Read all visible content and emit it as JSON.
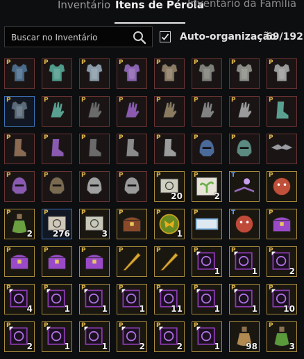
{
  "tabs": [
    {
      "label": "Inventário"
    },
    {
      "label": "Itens de Pérola"
    },
    {
      "label": "Inventário da Família"
    }
  ],
  "search": {
    "placeholder": "Buscar no Inventário"
  },
  "auto_organize": {
    "label": "Auto-organização",
    "checked": true
  },
  "capacity": "69/192",
  "slot_mark": "P",
  "slot_mark_alt": "T",
  "colors": {
    "border_red": "#6b3434",
    "border_gold": "#a88a3c",
    "border_blue": "#3f73b8"
  },
  "slots": [
    {
      "icon": "costume-armor-icon",
      "color": "#4a6a8a",
      "qty": "",
      "mark": "P",
      "border": "red"
    },
    {
      "icon": "teal-armor-icon",
      "color": "#4f9a8a",
      "qty": "",
      "mark": "P",
      "border": "red"
    },
    {
      "icon": "gold-armor-icon",
      "color": "#8a9aa8",
      "qty": "",
      "mark": "P",
      "border": "red"
    },
    {
      "icon": "purple-armor-icon",
      "color": "#8a62b0",
      "qty": "",
      "mark": "P",
      "border": "red"
    },
    {
      "icon": "bronze-armor-icon",
      "color": "#8a7a62",
      "qty": "",
      "mark": "P",
      "border": "red"
    },
    {
      "icon": "grey-armor-icon",
      "color": "#7e7e78",
      "qty": "",
      "mark": "P",
      "border": "red"
    },
    {
      "icon": "grey-armor-icon",
      "color": "#8c8c86",
      "qty": "",
      "mark": "P",
      "border": "red"
    },
    {
      "icon": "silver-armor-icon",
      "color": "#9a9a9a",
      "qty": "",
      "mark": "P",
      "border": "red"
    },
    {
      "icon": "dark-armor-icon",
      "color": "#5a6a7a",
      "qty": "",
      "mark": "P",
      "border": "blue"
    },
    {
      "icon": "teal-gloves-icon",
      "color": "#5aa090",
      "qty": "",
      "mark": "P",
      "border": "red"
    },
    {
      "icon": "gold-gloves-icon",
      "color": "#6a6a6a",
      "qty": "",
      "mark": "P",
      "border": "red"
    },
    {
      "icon": "purple-gloves-icon",
      "color": "#8a5ab0",
      "qty": "",
      "mark": "P",
      "border": "red"
    },
    {
      "icon": "bronze-gloves-icon",
      "color": "#8a7a60",
      "qty": "",
      "mark": "P",
      "border": "red"
    },
    {
      "icon": "grey-gloves-icon",
      "color": "#828282",
      "qty": "",
      "mark": "P",
      "border": "red"
    },
    {
      "icon": "silver-gloves-icon",
      "color": "#9a9a9a",
      "qty": "",
      "mark": "P",
      "border": "red"
    },
    {
      "icon": "teal-boots-icon",
      "color": "#5aa090",
      "qty": "",
      "mark": "P",
      "border": "red"
    },
    {
      "icon": "brown-boots-icon",
      "color": "#8a6a52",
      "qty": "",
      "mark": "P",
      "border": "red"
    },
    {
      "icon": "purple-boots-icon",
      "color": "#8a5ab0",
      "qty": "",
      "mark": "P",
      "border": "red"
    },
    {
      "icon": "dark-boots-icon",
      "color": "#6a6a6a",
      "qty": "",
      "mark": "P",
      "border": "red"
    },
    {
      "icon": "grey-boots-icon",
      "color": "#8a8a8a",
      "qty": "",
      "mark": "P",
      "border": "red"
    },
    {
      "icon": "silver-boots-icon",
      "color": "#9c9c9c",
      "qty": "",
      "mark": "P",
      "border": "red"
    },
    {
      "icon": "blue-helmet-icon",
      "color": "#4a6a9a",
      "qty": "",
      "mark": "P",
      "border": "red"
    },
    {
      "icon": "teal-helmet-icon",
      "color": "#5a8a80",
      "qty": "",
      "mark": "P",
      "border": "red"
    },
    {
      "icon": "winged-mask-icon",
      "color": "#9a9aa0",
      "qty": "",
      "mark": "P",
      "border": "red"
    },
    {
      "icon": "purple-helmet-icon",
      "color": "#8a5ab0",
      "qty": "",
      "mark": "P",
      "border": "red"
    },
    {
      "icon": "gold-helmet-icon",
      "color": "#7a6a50",
      "qty": "",
      "mark": "P",
      "border": "red"
    },
    {
      "icon": "silver-helmet-icon",
      "color": "#a0a0a0",
      "qty": "",
      "mark": "P",
      "border": "red"
    },
    {
      "icon": "knight-helmet-icon",
      "color": "#9a9a9a",
      "qty": "",
      "mark": "P",
      "border": "red"
    },
    {
      "icon": "scroll-icon",
      "color": "#cfcfc0",
      "qty": "20",
      "mark": "P",
      "border": "gold"
    },
    {
      "icon": "sprout-icon",
      "color": "#6ab04a",
      "qty": "2",
      "mark": "P",
      "border": "gold"
    },
    {
      "icon": "magic-book-icon",
      "color": "#9a6ac0",
      "qty": "",
      "mark": "T",
      "border": "gold"
    },
    {
      "icon": "red-creature-icon",
      "color": "#c0503a",
      "qty": "",
      "mark": "P",
      "border": "gold"
    },
    {
      "icon": "potion-green-icon",
      "color": "#6aa040",
      "qty": "2",
      "mark": "P",
      "border": "gold"
    },
    {
      "icon": "scroll-red-icon",
      "color": "#d0c8b8",
      "qty": "276",
      "mark": "P",
      "border": "blue"
    },
    {
      "icon": "scroll-icon",
      "color": "#c8c8b8",
      "qty": "3",
      "mark": "P",
      "border": "gold"
    },
    {
      "icon": "chest-brown-icon",
      "color": "#8a4a2a",
      "qty": "",
      "mark": "P",
      "border": "gold"
    },
    {
      "icon": "butterfly-coin-icon",
      "color": "#e8b020",
      "qty": "1",
      "mark": "P",
      "border": "gold"
    },
    {
      "icon": "blue-cards-icon",
      "color": "#7ab0e0",
      "qty": "",
      "mark": "P",
      "border": "gold"
    },
    {
      "icon": "red-creature-icon",
      "color": "#c04a3a",
      "qty": "",
      "mark": "T",
      "border": "gold"
    },
    {
      "icon": "purple-chest-icon",
      "color": "#9a4ac8",
      "qty": "",
      "mark": "P",
      "border": "gold"
    },
    {
      "icon": "purple-chest-icon",
      "color": "#9a4ac8",
      "qty": "",
      "mark": "P",
      "border": "gold"
    },
    {
      "icon": "purple-chest-icon",
      "color": "#9a4ac8",
      "qty": "",
      "mark": "P",
      "border": "gold"
    },
    {
      "icon": "purple-chest-icon",
      "color": "#9a4ac8",
      "qty": "",
      "mark": "P",
      "border": "gold"
    },
    {
      "icon": "gold-feather-icon",
      "color": "#d8a830",
      "qty": "",
      "mark": "P",
      "border": "gold"
    },
    {
      "icon": "gold-feather-icon",
      "color": "#d8a830",
      "qty": "",
      "mark": "P",
      "border": "gold"
    },
    {
      "icon": "pearl-coupon-icon",
      "color": "#8a3ab0",
      "qty": "1",
      "mark": "P",
      "border": "gold"
    },
    {
      "icon": "pearl-coupon-icon",
      "color": "#8a3ab0",
      "qty": "1",
      "mark": "P",
      "border": "gold"
    },
    {
      "icon": "pearl-coupon-icon",
      "color": "#8a3ab0",
      "qty": "2",
      "mark": "P",
      "border": "gold"
    },
    {
      "icon": "pearl-coupon-icon",
      "color": "#8a3ab0",
      "qty": "4",
      "mark": "P",
      "border": "gold"
    },
    {
      "icon": "pearl-coupon-icon",
      "color": "#8a3ab0",
      "qty": "1",
      "mark": "P",
      "border": "gold"
    },
    {
      "icon": "pearl-coupon-icon",
      "color": "#8a3ab0",
      "qty": "1",
      "mark": "P",
      "border": "gold"
    },
    {
      "icon": "pearl-coupon-icon",
      "color": "#8a3ab0",
      "qty": "1",
      "mark": "P",
      "border": "gold"
    },
    {
      "icon": "pearl-coupon-icon",
      "color": "#8a3ab0",
      "qty": "11",
      "mark": "P",
      "border": "gold"
    },
    {
      "icon": "pearl-coupon-icon",
      "color": "#8a3ab0",
      "qty": "1",
      "mark": "P",
      "border": "gold"
    },
    {
      "icon": "pearl-coupon-icon",
      "color": "#8a3ab0",
      "qty": "1",
      "mark": "P",
      "border": "gold"
    },
    {
      "icon": "pearl-coupon-icon",
      "color": "#8a3ab0",
      "qty": "10",
      "mark": "P",
      "border": "gold"
    },
    {
      "icon": "pearl-coupon-icon",
      "color": "#8a3ab0",
      "qty": "2",
      "mark": "P",
      "border": "gold"
    },
    {
      "icon": "pearl-coupon-icon",
      "color": "#8a3ab0",
      "qty": "1",
      "mark": "P",
      "border": "gold"
    },
    {
      "icon": "pearl-coupon-icon",
      "color": "#8a3ab0",
      "qty": "1",
      "mark": "P",
      "border": "gold"
    },
    {
      "icon": "pearl-coupon-icon",
      "color": "#8a3ab0",
      "qty": "2",
      "mark": "P",
      "border": "gold"
    },
    {
      "icon": "pearl-coupon-icon",
      "color": "#8a3ab0",
      "qty": "2",
      "mark": "P",
      "border": "gold"
    },
    {
      "icon": "pearl-coupon-icon",
      "color": "#8a3ab0",
      "qty": "1",
      "mark": "P",
      "border": "gold"
    },
    {
      "icon": "elixir-bottle-icon",
      "color": "#b08a50",
      "qty": "98",
      "mark": "",
      "border": "gold"
    },
    {
      "icon": "green-vase-icon",
      "color": "#5a9a3a",
      "qty": "3",
      "mark": "P",
      "border": "gold"
    }
  ]
}
